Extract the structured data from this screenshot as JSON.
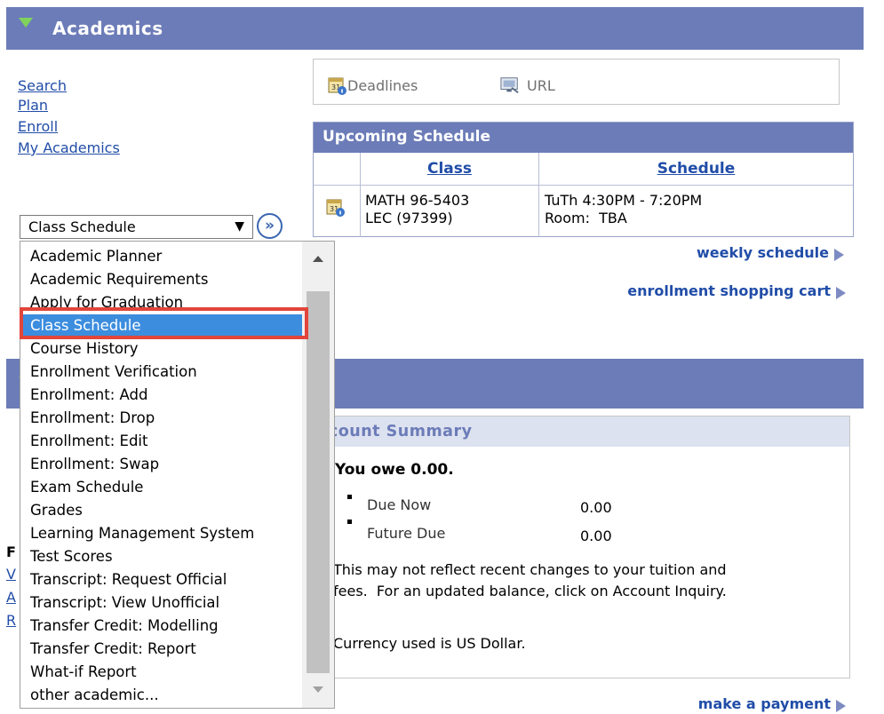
{
  "academics": {
    "title": "Academics",
    "links": [
      "Search",
      "Plan",
      "Enroll",
      "My Academics"
    ],
    "select": {
      "value": "Class Schedule",
      "go_label": "»"
    },
    "dropdown_options": [
      "Academic Planner",
      "Academic Requirements",
      "Apply for Graduation",
      "Class Schedule",
      "Course History",
      "Enrollment Verification",
      "Enrollment: Add",
      "Enrollment: Drop",
      "Enrollment: Edit",
      "Enrollment: Swap",
      "Exam Schedule",
      "Grades",
      "Learning Management System",
      "Test Scores",
      "Transcript: Request Official",
      "Transcript: View Unofficial",
      "Transfer Credit: Modelling",
      "Transfer Credit: Report",
      "What-if Report",
      "other academic..."
    ],
    "selected_option": "Class Schedule",
    "toolbar": {
      "deadlines": "Deadlines",
      "url": "URL"
    },
    "upcoming": {
      "title": "Upcoming Schedule",
      "col_class": "Class",
      "col_schedule": "Schedule",
      "class_line1": "MATH 96-5403",
      "class_line2": "LEC (97399)",
      "sched_line1": "TuTh 4:30PM - 7:20PM",
      "sched_line2": "Room:  TBA"
    },
    "weekly_schedule": "weekly schedule",
    "shopping_cart": "enrollment shopping cart"
  },
  "finances": {
    "summary_title": "ccount Summary",
    "you_owe": "You owe 0.00.",
    "due_now_label": "Due Now",
    "due_now_value": "0.00",
    "future_due_label": "Future Due",
    "future_due_value": "0.00",
    "notice_line1": "This may not reflect recent changes to your tuition and",
    "notice_line2": "fees.  For an updated balance, click on Account Inquiry.",
    "currency": "Currency used is US Dollar.",
    "make_payment": "make a payment",
    "partial_labels": [
      "F",
      "V",
      "A",
      "R"
    ]
  },
  "colors": {
    "header": "#6c7cb8",
    "selected": "#3c8dde",
    "highlight_outline": "#e2453a",
    "link": "#214da8"
  }
}
